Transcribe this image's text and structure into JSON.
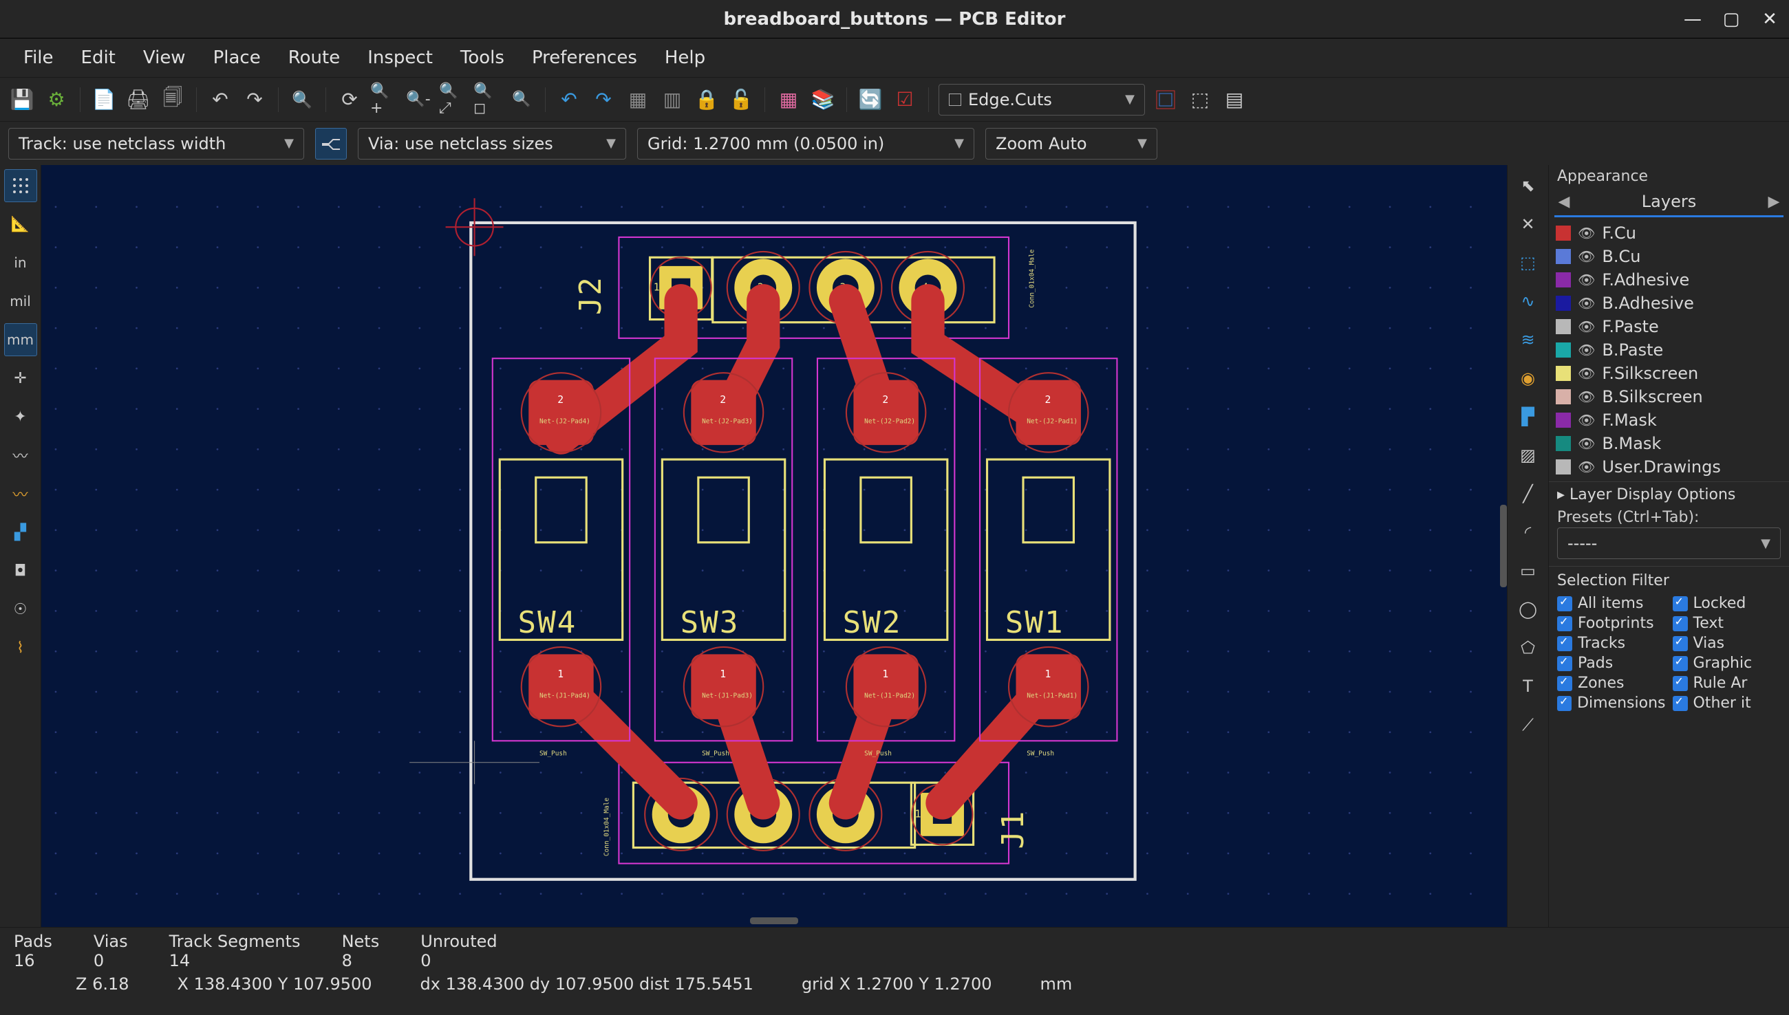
{
  "window": {
    "title": "breadboard_buttons — PCB Editor"
  },
  "menu": [
    "File",
    "Edit",
    "View",
    "Place",
    "Route",
    "Inspect",
    "Tools",
    "Preferences",
    "Help"
  ],
  "toolbar_layer_dropdown": "Edge.Cuts",
  "options": {
    "track": "Track: use netclass width",
    "via": "Via: use netclass sizes",
    "grid": "Grid: 1.2700 mm (0.0500 in)",
    "zoom": "Zoom Auto"
  },
  "appearance": {
    "title": "Appearance",
    "tab": "Layers",
    "layer_display": "Layer Display Options",
    "presets_label": "Presets (Ctrl+Tab):",
    "presets_value": "-----",
    "layers": [
      {
        "name": "F.Cu",
        "color": "#c83232"
      },
      {
        "name": "B.Cu",
        "color": "#5a7ad8"
      },
      {
        "name": "F.Adhesive",
        "color": "#8a2aa8"
      },
      {
        "name": "B.Adhesive",
        "color": "#1a1aa0"
      },
      {
        "name": "F.Paste",
        "color": "#b8b8b8"
      },
      {
        "name": "B.Paste",
        "color": "#1aa8a8"
      },
      {
        "name": "F.Silkscreen",
        "color": "#e8e078"
      },
      {
        "name": "B.Silkscreen",
        "color": "#d8b0a8"
      },
      {
        "name": "F.Mask",
        "color": "#8a2aa8"
      },
      {
        "name": "B.Mask",
        "color": "#168a80"
      },
      {
        "name": "User.Drawings",
        "color": "#b8b8b8"
      }
    ]
  },
  "selection_filter": {
    "title": "Selection Filter",
    "items_col1": [
      "All items",
      "Footprints",
      "Tracks",
      "Pads",
      "Zones",
      "Dimensions"
    ],
    "items_col2": [
      "Locked",
      "Text",
      "Vias",
      "Graphic",
      "Rule Ar",
      "Other it"
    ]
  },
  "status": {
    "col_labels": [
      "Pads",
      "Vias",
      "Track Segments",
      "Nets",
      "Unrouted"
    ],
    "col_values": [
      "16",
      "0",
      "14",
      "8",
      "0"
    ],
    "z": "Z 6.18",
    "xy": "X 138.4300  Y 107.9500",
    "dxy": "dx 138.4300  dy 107.9500  dist 175.5451",
    "grid": "grid X 1.2700  Y 1.2700",
    "units": "mm"
  },
  "pcb": {
    "j_top": "J2",
    "j_bot": "J1",
    "switches": [
      "SW4",
      "SW3",
      "SW2",
      "SW1"
    ],
    "pad1": "1",
    "pad2": "2",
    "pad3": "3",
    "pad4": "4",
    "sw_footprint_text": "SW_Push",
    "conn_text_top": "Conn_01x04_Male",
    "conn_text_bot": "Conn_01x04_Male"
  }
}
